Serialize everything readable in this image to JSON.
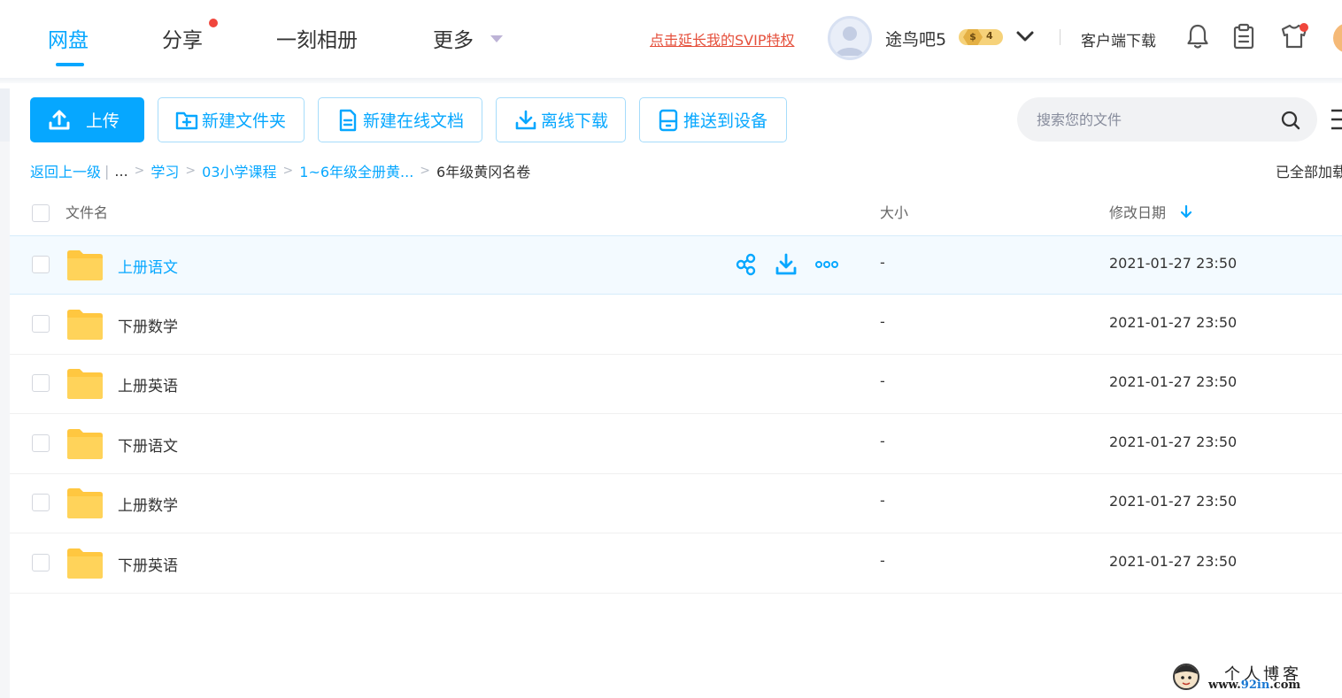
{
  "nav": {
    "items": [
      {
        "label": "网盘",
        "active": true
      },
      {
        "label": "分享",
        "badge_dot": true
      },
      {
        "label": "一刻相册"
      },
      {
        "label": "更多"
      }
    ],
    "svip_link": "点击延长我的SVIP特权",
    "username": "途鸟吧5",
    "vip_badge": {
      "symbol": "$",
      "level": "4"
    },
    "client_download": "客户端下载",
    "icons": [
      "bell-icon",
      "clipboard-icon",
      "tshirt-icon"
    ]
  },
  "toolbar": {
    "upload": "上传",
    "new_folder": "新建文件夹",
    "new_online_doc": "新建在线文档",
    "offline_download": "离线下载",
    "push_to_device": "推送到设备",
    "search_placeholder": "搜索您的文件"
  },
  "breadcrumb": {
    "back": "返回上一级",
    "separator_bar": "|",
    "ellipsis": "...",
    "separator": ">",
    "links": [
      "学习",
      "03小学课程",
      "1~6年级全册黄..."
    ],
    "current": "6年级黄冈名卷",
    "status": "已全部加载"
  },
  "table": {
    "columns": {
      "name": "文件名",
      "size": "大小",
      "date": "修改日期"
    },
    "sort": "date-desc",
    "rows": [
      {
        "name": "上册语文",
        "size": "-",
        "date": "2021-01-27 23:50",
        "hovered": true
      },
      {
        "name": "下册数学",
        "size": "-",
        "date": "2021-01-27 23:50"
      },
      {
        "name": "上册英语",
        "size": "-",
        "date": "2021-01-27 23:50"
      },
      {
        "name": "下册语文",
        "size": "-",
        "date": "2021-01-27 23:50"
      },
      {
        "name": "上册数学",
        "size": "-",
        "date": "2021-01-27 23:50"
      },
      {
        "name": "下册英语",
        "size": "-",
        "date": "2021-01-27 23:50"
      }
    ]
  },
  "watermark": {
    "line1": "个人博客",
    "line2_prefix": "www.",
    "line2_highlight": "92in",
    "line2_suffix": ".com"
  },
  "colors": {
    "accent": "#06a7ff",
    "svip_red": "#e5503c",
    "folder": "#ffc740",
    "hover_row": "#f3faff"
  }
}
